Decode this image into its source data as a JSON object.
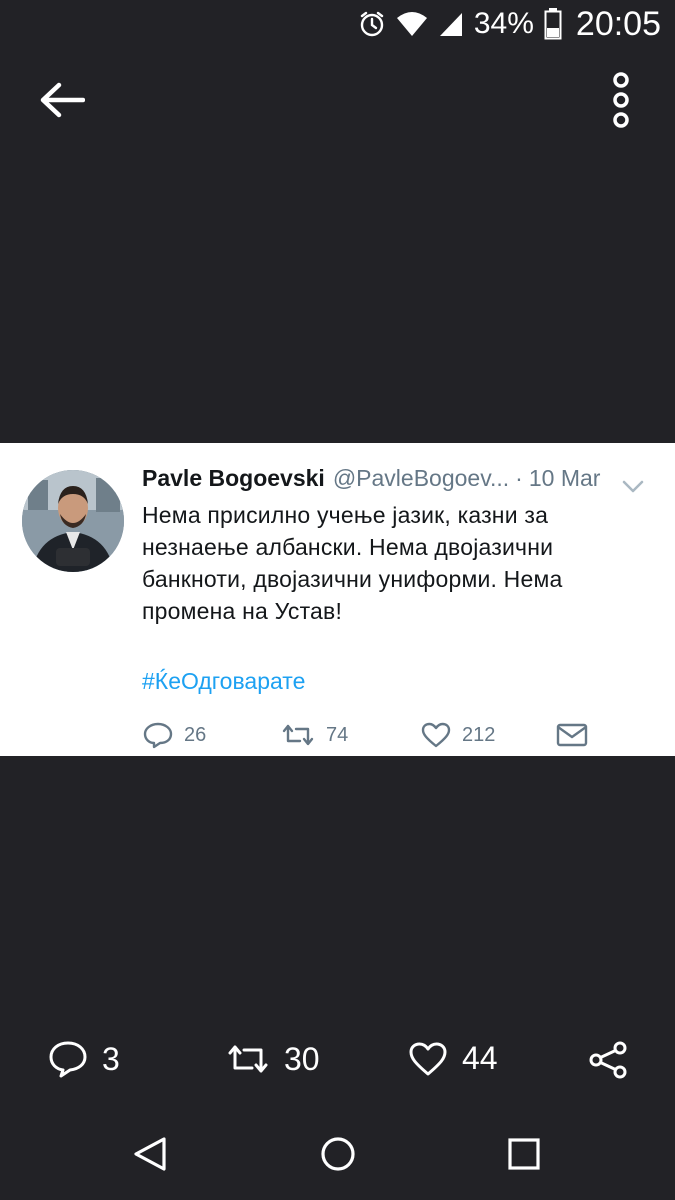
{
  "status_bar": {
    "icons": [
      "alarm-icon",
      "wifi-icon",
      "signal-icon",
      "battery-icon"
    ],
    "battery_percent": "34%",
    "time": "20:05"
  },
  "top_bar": {
    "back_icon": "arrow-left-icon",
    "menu_icon": "vertical-dots-icon"
  },
  "tweet": {
    "author_name": "Pavle Bogoevski",
    "author_handle": "@PavleBogoev...",
    "separator": "·",
    "date": "10 Mar",
    "text_lines": [
      "Нема присилно учење јазик, казни за",
      "незнаење албански. Нема двојазични",
      "банкноти, двојазични униформи. Нема",
      "промена на Устав!"
    ],
    "hashtag": "#ЌеОдговарате",
    "actions": {
      "replies": "26",
      "retweets": "74",
      "likes": "212"
    }
  },
  "bottom_actions": {
    "comments": "3",
    "reposts": "30",
    "likes": "44"
  },
  "nav_bar": {
    "icons": [
      "back-triangle-icon",
      "home-circle-icon",
      "recents-square-icon"
    ]
  },
  "colors": {
    "background": "#222226",
    "card": "#ffffff",
    "link": "#1da1f2",
    "muted": "#657786"
  }
}
